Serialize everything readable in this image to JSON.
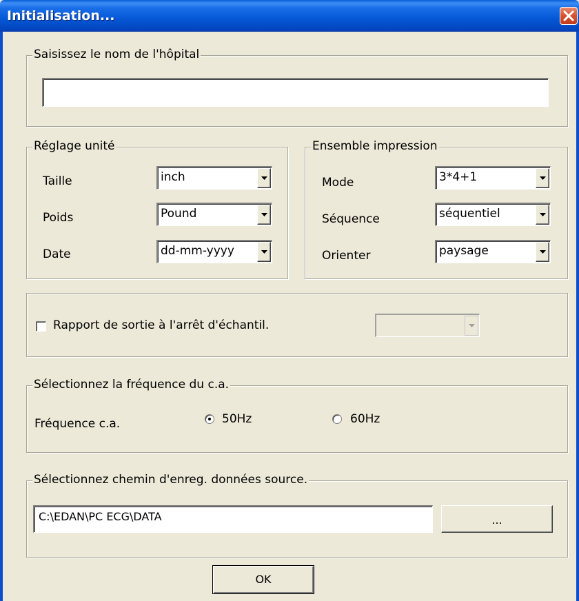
{
  "window": {
    "title": "Initialisation..."
  },
  "hospital": {
    "legend": "Saisissez le nom de l'hôpital",
    "value": ""
  },
  "unit_settings": {
    "legend": "Réglage unité",
    "rows": [
      {
        "label": "Taille",
        "value": "inch"
      },
      {
        "label": "Poids",
        "value": "Pound"
      },
      {
        "label": "Date",
        "value": "dd-mm-yyyy"
      }
    ]
  },
  "print_settings": {
    "legend": "Ensemble impression",
    "rows": [
      {
        "label": "Mode",
        "value": "3*4+1"
      },
      {
        "label": "Séquence",
        "value": "séquentiel"
      },
      {
        "label": "Orienter",
        "value": "paysage"
      }
    ]
  },
  "report": {
    "checkbox_label": "Rapport de sortie à l'arrêt d'échantil.",
    "checked": false,
    "combo_value": ""
  },
  "frequency": {
    "legend": "Sélectionnez la fréquence du c.a.",
    "label": "Fréquence c.a.",
    "options": [
      {
        "label": "50Hz",
        "checked": true
      },
      {
        "label": "60Hz",
        "checked": false
      }
    ]
  },
  "data_path": {
    "legend": "Sélectionnez chemin d'enreg. données source.",
    "value": "C:\\EDAN\\PC ECG\\DATA",
    "browse_label": "..."
  },
  "footer": {
    "ok_label": "OK"
  },
  "icons": {
    "close": "close-icon",
    "dropdown": "chevron-down-icon",
    "checkbox": "checkbox-icon",
    "radio": "radio-icon"
  },
  "colors": {
    "titlebar": "#0557d6",
    "close": "#d5532f",
    "dialog_bg": "#ece9d8"
  }
}
